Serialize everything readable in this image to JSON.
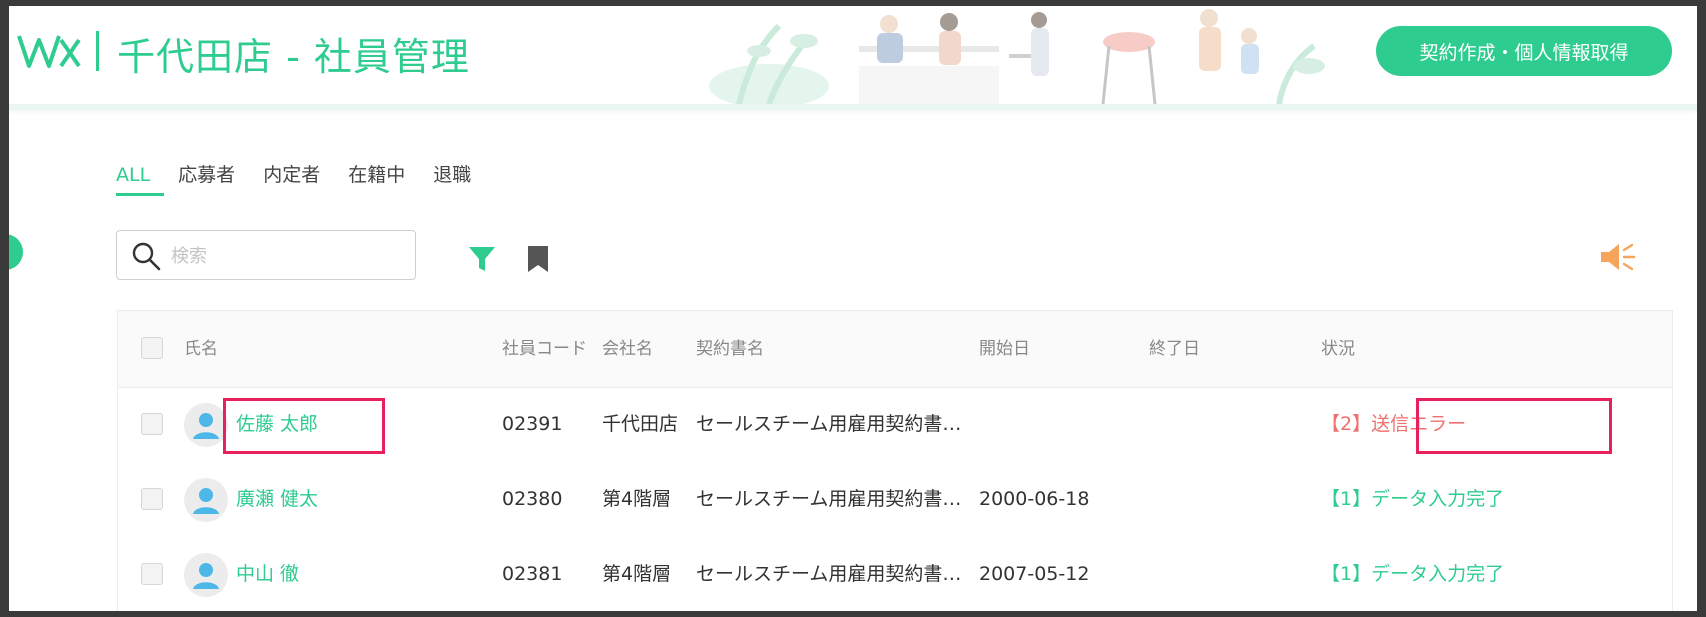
{
  "header": {
    "title": "千代田店 - 社員管理",
    "primary_button": "契約作成・個人情報取得"
  },
  "tabs": [
    {
      "label": "ALL",
      "active": true
    },
    {
      "label": "応募者",
      "active": false
    },
    {
      "label": "内定者",
      "active": false
    },
    {
      "label": "在籍中",
      "active": false
    },
    {
      "label": "退職",
      "active": false
    }
  ],
  "search": {
    "placeholder": "検索",
    "value": ""
  },
  "icons": {
    "search": "search-icon",
    "filter": "filter-icon",
    "bookmark": "bookmark-icon",
    "speaker": "speaker-icon",
    "avatar": "user-avatar-icon"
  },
  "table": {
    "columns": [
      "氏名",
      "社員コード",
      "会社名",
      "契約書名",
      "開始日",
      "終了日",
      "状況"
    ],
    "rows": [
      {
        "name": "佐藤 太郎",
        "code": "02391",
        "company": "千代田店",
        "contract": "セールスチーム用雇用契約書…",
        "start": "",
        "end": "",
        "status": "【2】送信エラー",
        "status_type": "error"
      },
      {
        "name": "廣瀬 健太",
        "code": "02380",
        "company": "第4階層",
        "contract": "セールスチーム用雇用契約書…",
        "start": "2000-06-18",
        "end": "",
        "status": "【1】データ入力完了",
        "status_type": "ok"
      },
      {
        "name": "中山 徹",
        "code": "02381",
        "company": "第4階層",
        "contract": "セールスチーム用雇用契約書…",
        "start": "2007-05-12",
        "end": "",
        "status": "【1】データ入力完了",
        "status_type": "ok"
      }
    ]
  },
  "colors": {
    "accent": "#2ecc8f",
    "error": "#f07070",
    "highlight": "#e8205c",
    "speaker": "#f5a45a"
  }
}
